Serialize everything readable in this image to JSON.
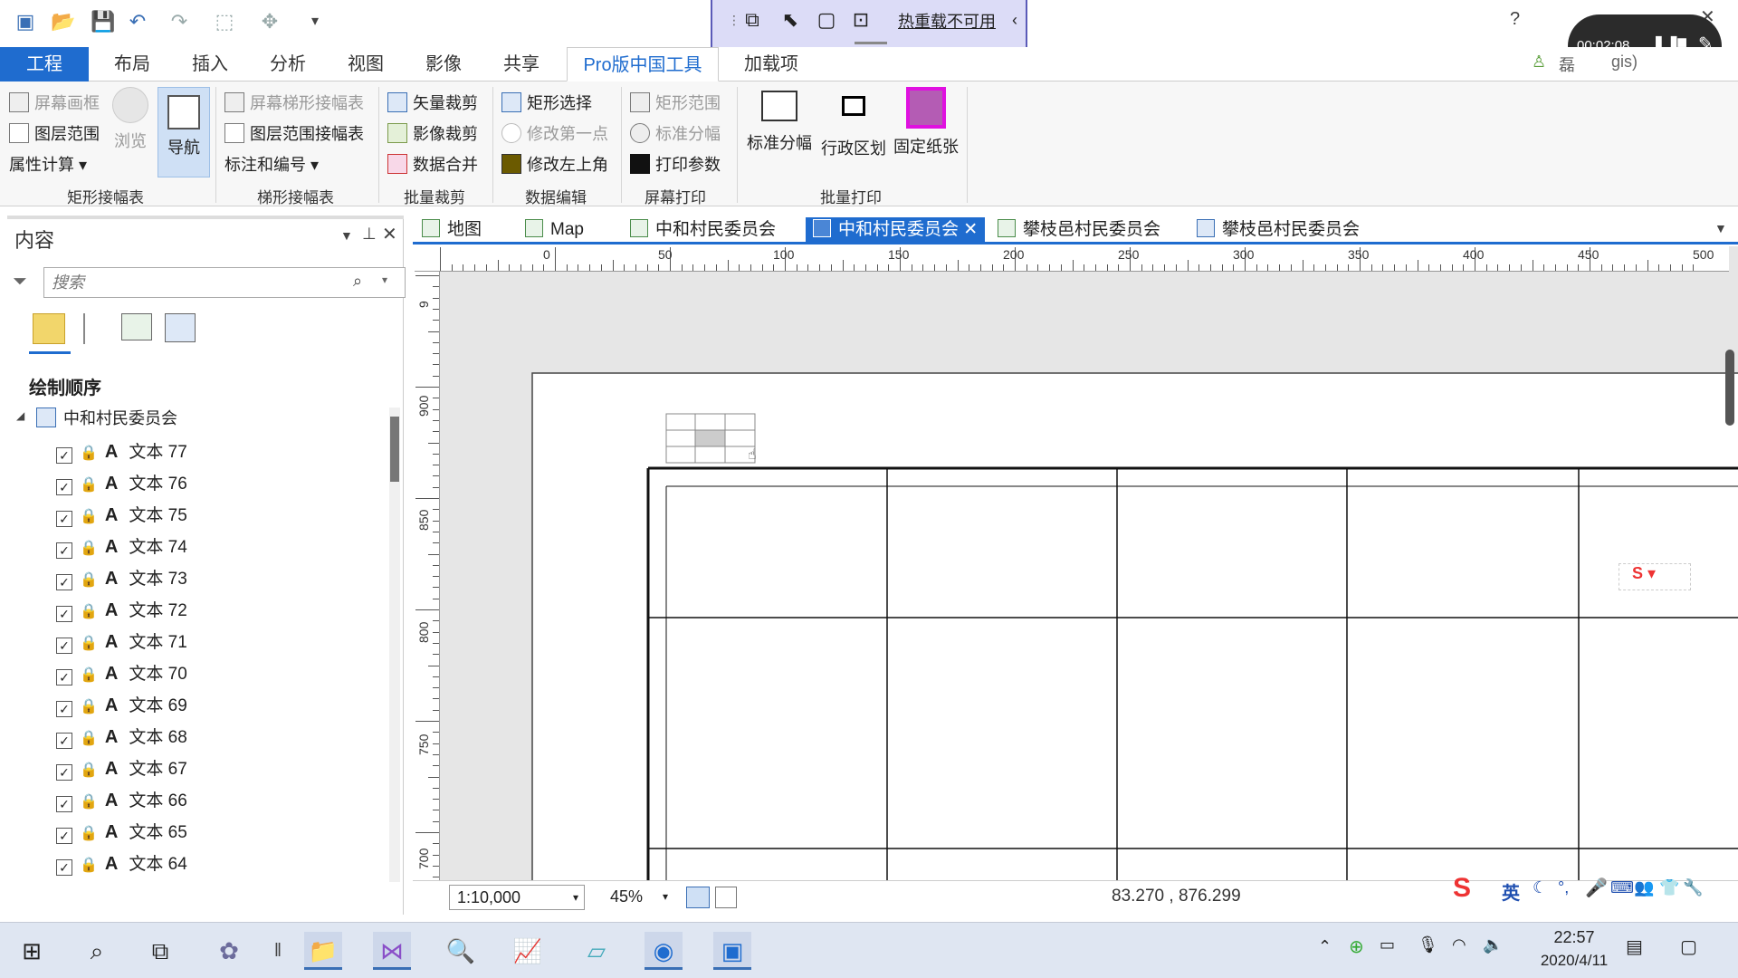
{
  "hot_reload": {
    "label": "热重载不可用"
  },
  "title_controls": {
    "help": "?",
    "close": "✕"
  },
  "recorder": {
    "time": "00:02:08"
  },
  "user": {
    "name_fragment": "磊",
    "suffix_fragment": "gis)"
  },
  "ribbon_tabs": [
    "工程",
    "布局",
    "插入",
    "分析",
    "视图",
    "影像",
    "共享",
    "Pro版中国工具",
    "加载项"
  ],
  "ribbon": {
    "g1": {
      "items": [
        "屏幕画框",
        "图层范围",
        "属性计算"
      ],
      "browse": "浏览",
      "nav": "导航",
      "label": "矩形接幅表"
    },
    "g2": {
      "items": [
        "屏幕梯形接幅表",
        "图层范围接幅表",
        "标注和编号"
      ],
      "label": "梯形接幅表"
    },
    "g3": {
      "items": [
        "矢量裁剪",
        "影像裁剪",
        "数据合并"
      ],
      "label": "批量裁剪"
    },
    "g4": {
      "items": [
        "矩形选择",
        "修改第一点",
        "修改左上角"
      ],
      "label": "数据编辑"
    },
    "g5": {
      "items": [
        "矩形范围",
        "标准分幅",
        "打印参数"
      ],
      "label": "屏幕打印"
    },
    "g6": {
      "items": [
        "标准分幅",
        "行政区划",
        "固定纸张"
      ],
      "label": "批量打印"
    }
  },
  "contents": {
    "title": "内容",
    "search_placeholder": "搜索",
    "section": "绘制顺序",
    "root": "中和村民委员会",
    "layers": [
      "文本 77",
      "文本 76",
      "文本 75",
      "文本 74",
      "文本 73",
      "文本 72",
      "文本 71",
      "文本 70",
      "文本 69",
      "文本 68",
      "文本 67",
      "文本 66",
      "文本 65",
      "文本 64"
    ]
  },
  "view_tabs": [
    "地图",
    "Map",
    "中和村民委员会",
    "中和村民委员会",
    "攀枝邑村民委员会",
    "攀枝邑村民委员会"
  ],
  "active_view_tab": 3,
  "ruler_h": [
    "0",
    "50",
    "100",
    "150",
    "200",
    "250",
    "300",
    "350",
    "400",
    "450",
    "500"
  ],
  "ruler_v": [
    "9",
    "900",
    "850",
    "800",
    "750",
    "700"
  ],
  "status": {
    "scale": "1:10,000",
    "zoom": "45%",
    "coords": "83.270 , 876.299"
  },
  "ime": {
    "lang": "英"
  },
  "clock": {
    "time": "22:57",
    "date": "2020/4/11"
  }
}
